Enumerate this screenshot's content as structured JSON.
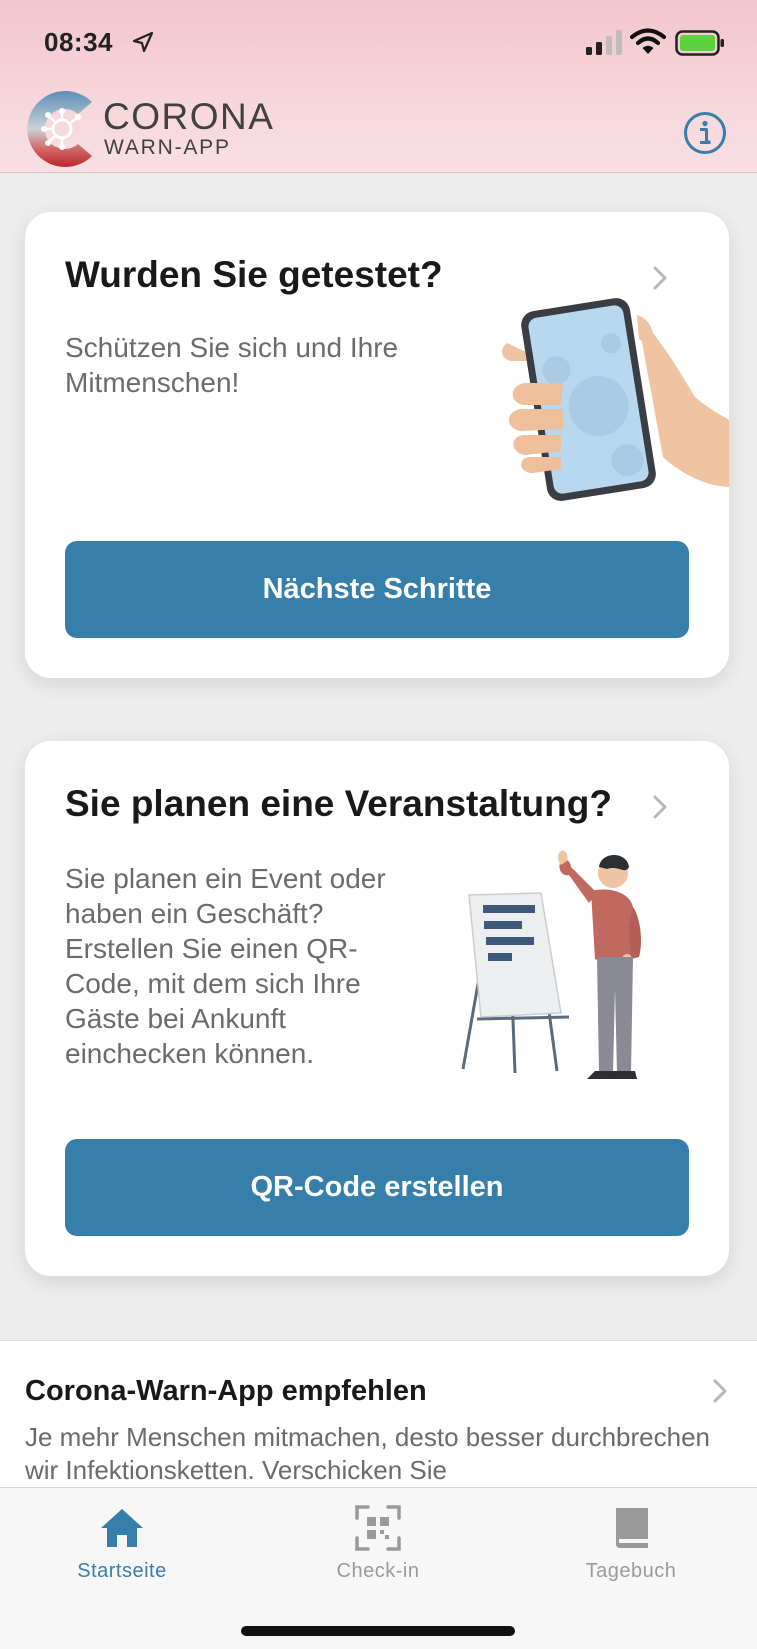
{
  "status_bar": {
    "time": "08:34",
    "location_icon": "location-arrow-icon",
    "signal_icon": "cellular-signal-icon",
    "wifi_icon": "wifi-icon",
    "battery_icon": "battery-icon",
    "battery_color": "#5cd23c"
  },
  "header": {
    "logo_title": "CORONA",
    "logo_subtitle": "WARN-APP",
    "info_icon": "info-icon",
    "accent_color": "#377fab"
  },
  "cards": [
    {
      "title": "Wurden Sie getestet?",
      "text": "Schützen Sie sich und Ihre Mitmenschen!",
      "button_label": "Nächste Schritte",
      "illustration": "hand-holding-phone-illustration"
    },
    {
      "title": "Sie planen eine Veranstaltung?",
      "text": "Sie planen ein Event oder haben ein Geschäft? Erstellen Sie einen QR-Code, mit dem sich Ihre Gäste bei Ankunft einchecken können.",
      "button_label": "QR-Code erstellen",
      "illustration": "person-presenting-flipchart-illustration"
    }
  ],
  "recommend": {
    "title": "Corona-Warn-App empfehlen",
    "text": "Je mehr Menschen mitmachen, desto besser durchbrechen wir Infektionsketten. Verschicken Sie"
  },
  "tabbar": {
    "tabs": [
      {
        "label": "Startseite",
        "icon": "home-icon",
        "active": true
      },
      {
        "label": "Check-in",
        "icon": "qr-code-scan-icon",
        "active": false
      },
      {
        "label": "Tagebuch",
        "icon": "book-icon",
        "active": false
      }
    ],
    "active_color": "#377fab",
    "inactive_color": "#9a9a9a"
  }
}
